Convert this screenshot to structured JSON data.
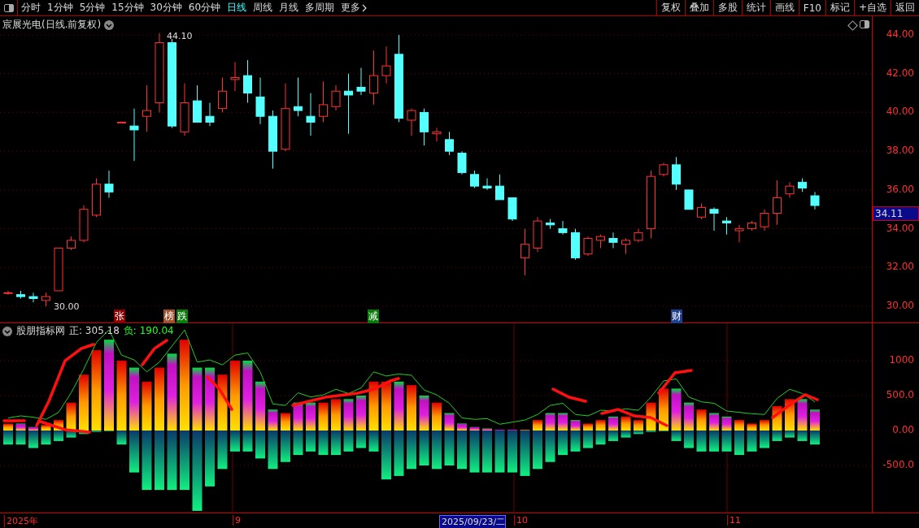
{
  "toolbar": {
    "periods": [
      {
        "label": "分时",
        "selected": false
      },
      {
        "label": "1分钟",
        "selected": false
      },
      {
        "label": "5分钟",
        "selected": false
      },
      {
        "label": "15分钟",
        "selected": false
      },
      {
        "label": "30分钟",
        "selected": false
      },
      {
        "label": "60分钟",
        "selected": false
      },
      {
        "label": "日线",
        "selected": true
      },
      {
        "label": "周线",
        "selected": false
      },
      {
        "label": "月线",
        "selected": false
      },
      {
        "label": "多周期",
        "selected": false
      },
      {
        "label": "更多",
        "selected": false
      }
    ],
    "buttons": [
      "复权",
      "叠加",
      "多股",
      "统计",
      "画线",
      "F10",
      "标记",
      "+自选",
      "返回"
    ]
  },
  "main_chart": {
    "title": "宸展光电(日线.前复权)",
    "high_label": "44.10",
    "low_label": "30.00",
    "markers": [
      {
        "text": "张",
        "color": "#8b0000"
      },
      {
        "text": "榜",
        "color": "#a0522d"
      },
      {
        "text": "跌",
        "color": "#0a7a0a"
      },
      {
        "text": "减",
        "color": "#0a7a0a"
      },
      {
        "text": "财",
        "color": "#1f3f8f"
      }
    ],
    "y_ticks": [
      "44.00",
      "42.00",
      "40.00",
      "38.00",
      "36.00",
      "34.00",
      "32.00",
      "30.00"
    ],
    "current_price": "34.11"
  },
  "indicator": {
    "name": "股朋指标网",
    "values": [
      {
        "kind": "positive",
        "text": "正: 305.18"
      },
      {
        "kind": "negative",
        "text": "负: 190.04"
      }
    ],
    "y_ticks": [
      "1000",
      "500.0",
      "0.00",
      "-500.0"
    ]
  },
  "x_axis": [
    {
      "text": "2025年",
      "selected": false
    },
    {
      "text": "9",
      "selected": false
    },
    {
      "text": "2025/09/23/二",
      "selected": true
    },
    {
      "text": "10",
      "selected": false
    },
    {
      "text": "11",
      "selected": false
    }
  ]
}
